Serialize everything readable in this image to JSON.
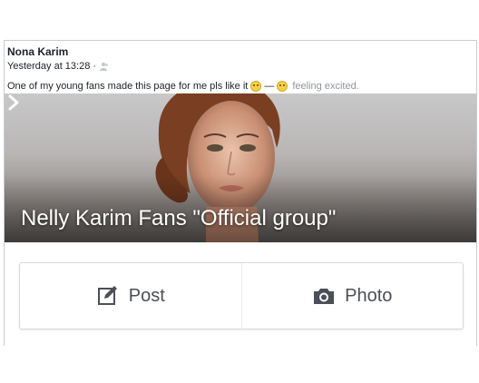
{
  "post": {
    "author": "Nona Karim",
    "timestamp": "Yesterday at 13:28 ·",
    "privacy_icon": "friends-icon",
    "text": "One of my young fans made this page for me pls like it",
    "emoji_smile": "smile-emoji",
    "dash": "—",
    "emoji_excited": "excited-emoji",
    "feeling": "feeling excited."
  },
  "group": {
    "title": "Nelly Karim Fans \"Official group\"",
    "chevron_icon": "chevron-right-icon"
  },
  "actions": {
    "post_label": "Post",
    "post_icon": "edit-icon",
    "photo_label": "Photo",
    "photo_icon": "camera-icon"
  }
}
